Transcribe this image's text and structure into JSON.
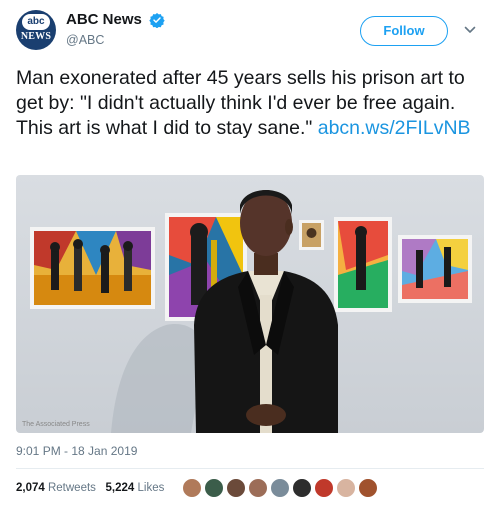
{
  "account": {
    "display_name": "ABC News",
    "handle": "@ABC",
    "avatar_top": "abc",
    "avatar_bottom": "NEWS"
  },
  "follow_label": "Follow",
  "tweet": {
    "text": "Man exonerated after 45 years sells his prison art to get by: \"I didn't actually think I'd ever be free again. This art is what I did to stay sane.\" ",
    "link": "abcn.ws/2FILvNB"
  },
  "media": {
    "credit": "The Associated Press"
  },
  "timestamp": "9:01 PM - 18 Jan 2019",
  "stats": {
    "retweets_count": "2,074",
    "retweets_label": "Retweets",
    "likes_count": "5,224",
    "likes_label": "Likes"
  },
  "colors": {
    "accent": "#1da1f2",
    "link": "#1b95e0",
    "muted": "#657786"
  }
}
